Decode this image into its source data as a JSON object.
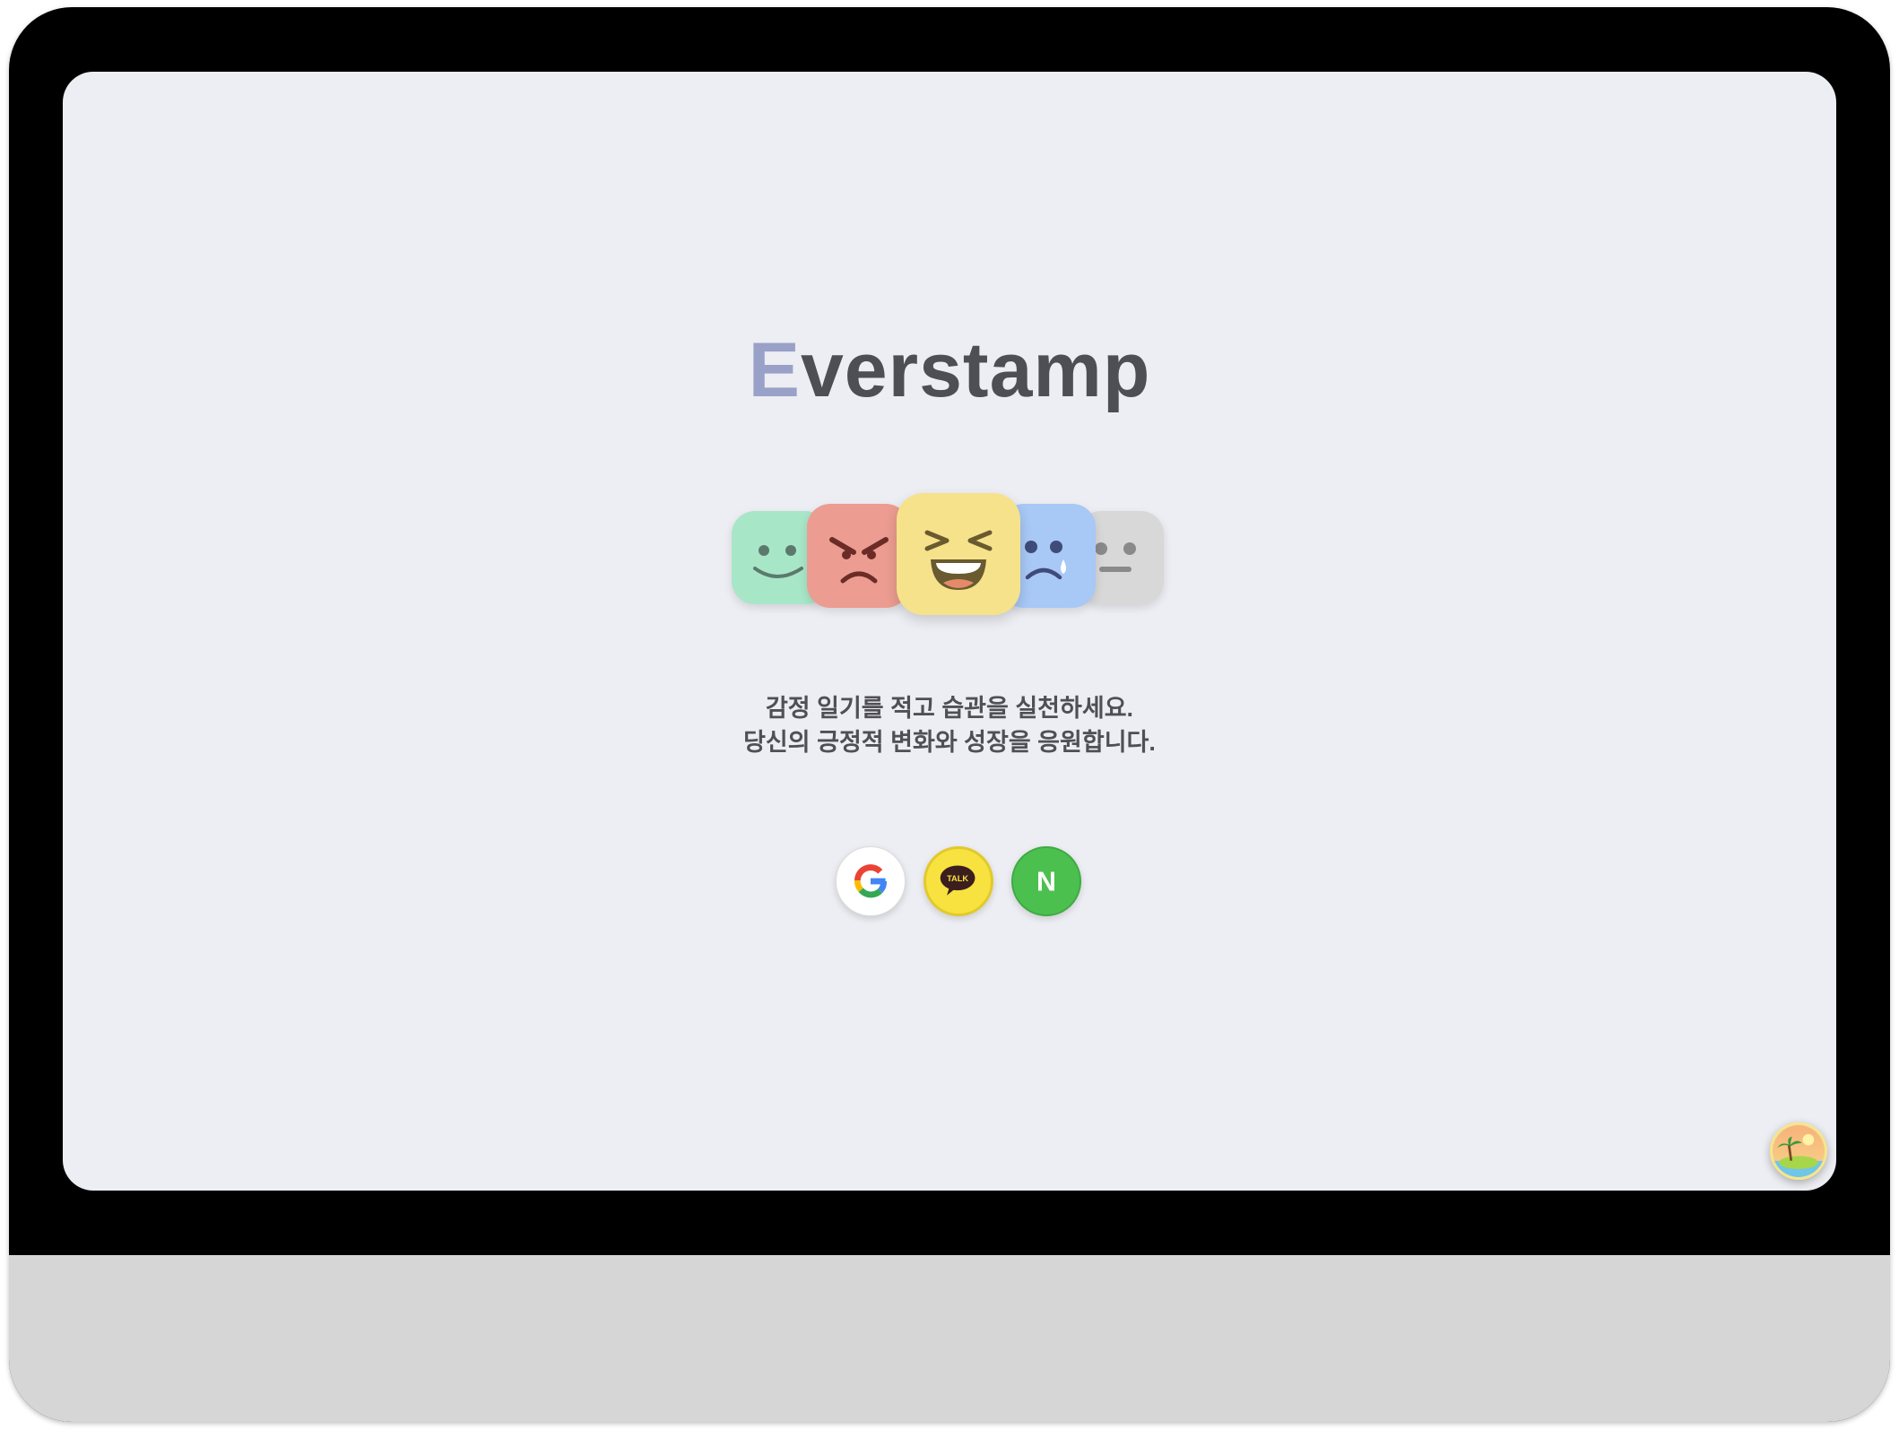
{
  "app": {
    "title_first_letter": "E",
    "title_rest": "verstamp"
  },
  "moods": [
    {
      "name": "happy",
      "color": "#a8e6c8",
      "icon": "smile-face-icon"
    },
    {
      "name": "angry",
      "color": "#ec9c90",
      "icon": "angry-face-icon"
    },
    {
      "name": "laughing",
      "color": "#f6e28a",
      "icon": "laughing-face-icon"
    },
    {
      "name": "sad",
      "color": "#a8c8f6",
      "icon": "crying-face-icon"
    },
    {
      "name": "neutral",
      "color": "#d8d8d8",
      "icon": "neutral-face-icon"
    }
  ],
  "tagline": {
    "line1": "감정 일기를 적고 습관을 실천하세요.",
    "line2": "당신의 긍정적 변화와 성장을 응원합니다."
  },
  "login": {
    "google": {
      "icon": "google-icon",
      "color": "#ffffff"
    },
    "kakao": {
      "icon": "kakao-talk-icon",
      "label": "TALK",
      "color": "#f7e23f"
    },
    "naver": {
      "icon": "naver-icon",
      "label": "N",
      "color": "#4cc04f"
    }
  },
  "colors": {
    "background": "#edeef3",
    "title": "#4e4e55",
    "title_accent": "#9aa1c8"
  }
}
